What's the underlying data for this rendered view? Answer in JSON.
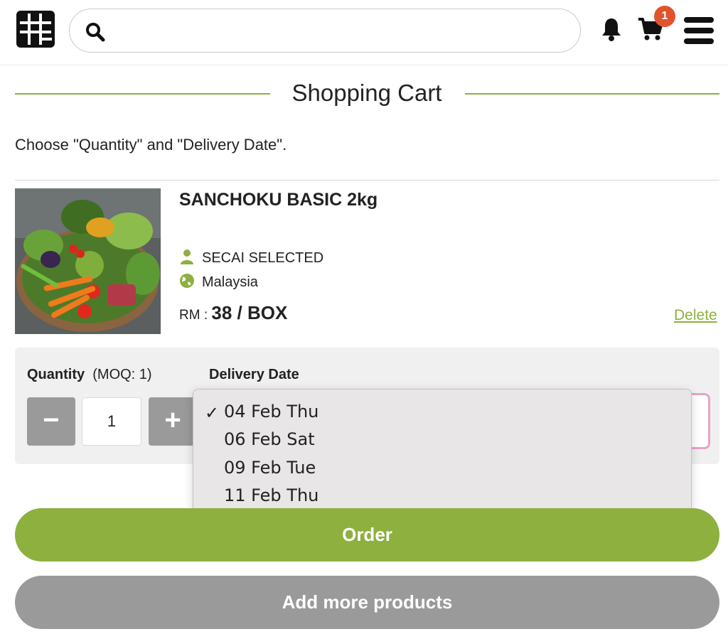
{
  "header": {
    "logo_icon": "grid-logo-icon",
    "search": {
      "icon": "search-icon",
      "placeholder": "",
      "value": ""
    },
    "notification_icon": "bell-icon",
    "cart_icon": "cart-icon",
    "cart_count": "1",
    "menu_icon": "hamburger-menu-icon"
  },
  "page": {
    "title": "Shopping Cart",
    "instruction": "Choose \"Quantity\" and \"Delivery Date\"."
  },
  "product": {
    "image_icon": "vegetable-basket-photo",
    "name": "SANCHOKU BASIC 2kg",
    "seller": "SECAI SELECTED",
    "seller_icon": "person-icon",
    "origin": "Malaysia",
    "origin_icon": "globe-icon",
    "currency_label": "RM : ",
    "price": "38 / BOX",
    "delete_label": "Delete"
  },
  "order_panel": {
    "quantity_label": "Quantity",
    "moq_label": "(MOQ: 1)",
    "decrement_label": "−",
    "quantity_value": "1",
    "increment_label": "+",
    "delivery_label": "Delivery Date",
    "selected_date": "04 Feb Thu",
    "options": [
      {
        "label": "04 Feb Thu",
        "selected": true
      },
      {
        "label": "06 Feb Sat",
        "selected": false
      },
      {
        "label": "09 Feb Tue",
        "selected": false
      },
      {
        "label": "11 Feb Thu",
        "selected": false
      }
    ],
    "check_mark": "✓"
  },
  "actions": {
    "order_label": "Order",
    "add_more_label": "Add more products"
  },
  "colors": {
    "accent_green": "#8db03f",
    "badge_orange": "#e0542d",
    "button_gray": "#9a9a9a",
    "select_focus_pink": "#e9a3c9"
  }
}
